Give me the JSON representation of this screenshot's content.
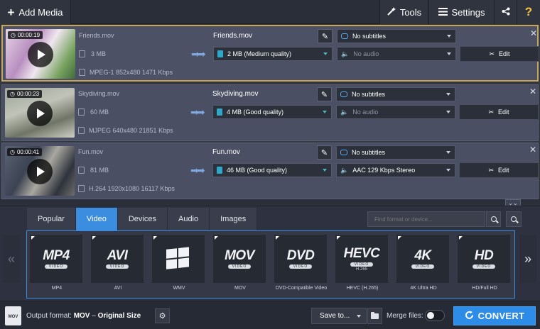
{
  "toolbar": {
    "add_media": "Add Media",
    "tools": "Tools",
    "settings": "Settings",
    "help": "?"
  },
  "files": [
    {
      "duration": "00:00:19",
      "source_name": "Friends.mov",
      "source_size": "3 MB",
      "source_meta": "MPEG-1 852x480 1471 Kbps",
      "output_name": "Friends.mov",
      "quality": "2 MB (Medium quality)",
      "subtitles": "No subtitles",
      "audio": "No audio",
      "edit": "Edit",
      "selected": true
    },
    {
      "duration": "00:00:23",
      "source_name": "Skydiving.mov",
      "source_size": "60 MB",
      "source_meta": "MJPEG 640x480 21851 Kbps",
      "output_name": "Skydiving.mov",
      "quality": "4 MB (Good quality)",
      "subtitles": "No subtitles",
      "audio": "No audio",
      "edit": "Edit",
      "selected": false
    },
    {
      "duration": "00:00:41",
      "source_name": "Fun.mov",
      "source_size": "81 MB",
      "source_meta": "H.264 1920x1080 16117 Kbps",
      "output_name": "Fun.mov",
      "quality": "46 MB (Good quality)",
      "subtitles": "No subtitles",
      "audio": "AAC 129 Kbps Stereo",
      "edit": "Edit",
      "selected": false
    }
  ],
  "format_panel": {
    "tabs": [
      "Popular",
      "Video",
      "Devices",
      "Audio",
      "Images"
    ],
    "active_tab": "Video",
    "search_placeholder": "Find format or device...",
    "formats": [
      {
        "big": "MP4",
        "pill": "VIDEO",
        "sub": "",
        "label": "MP4",
        "icon": "mp4-icon"
      },
      {
        "big": "AVI",
        "pill": "VIDEO",
        "sub": "",
        "label": "AVI",
        "icon": "avi-icon"
      },
      {
        "big": "",
        "pill": "",
        "sub": "",
        "label": "WMV",
        "icon": "windows-logo-icon"
      },
      {
        "big": "MOV",
        "pill": "VIDEO",
        "sub": "",
        "label": "MOV",
        "icon": "mov-icon"
      },
      {
        "big": "DVD",
        "pill": "VIDEO",
        "sub": "",
        "label": "DVD-Compatible Video",
        "icon": "dvd-icon"
      },
      {
        "big": "HEVC",
        "pill": "VIDEO",
        "sub": "H.265",
        "label": "HEVC (H.265)",
        "icon": "hevc-icon"
      },
      {
        "big": "4K",
        "pill": "VIDEO",
        "sub": "",
        "label": "4K Ultra HD",
        "icon": "4k-icon"
      },
      {
        "big": "HD",
        "pill": "VIDEO",
        "sub": "",
        "label": "HD/Full HD",
        "icon": "hd-icon"
      }
    ]
  },
  "bottom": {
    "output_icon_text": "MOV",
    "output_prefix": "Output format: ",
    "output_format": "MOV",
    "output_sep": " – ",
    "output_size": "Original Size",
    "save_to": "Save to...",
    "merge_files": "Merge files:",
    "merge_enabled": false,
    "convert": "CONVERT"
  },
  "colors": {
    "accent": "#3b8de0",
    "convert": "#2d8ce8",
    "selected_border": "#c8a55a",
    "help": "#f4c542"
  }
}
